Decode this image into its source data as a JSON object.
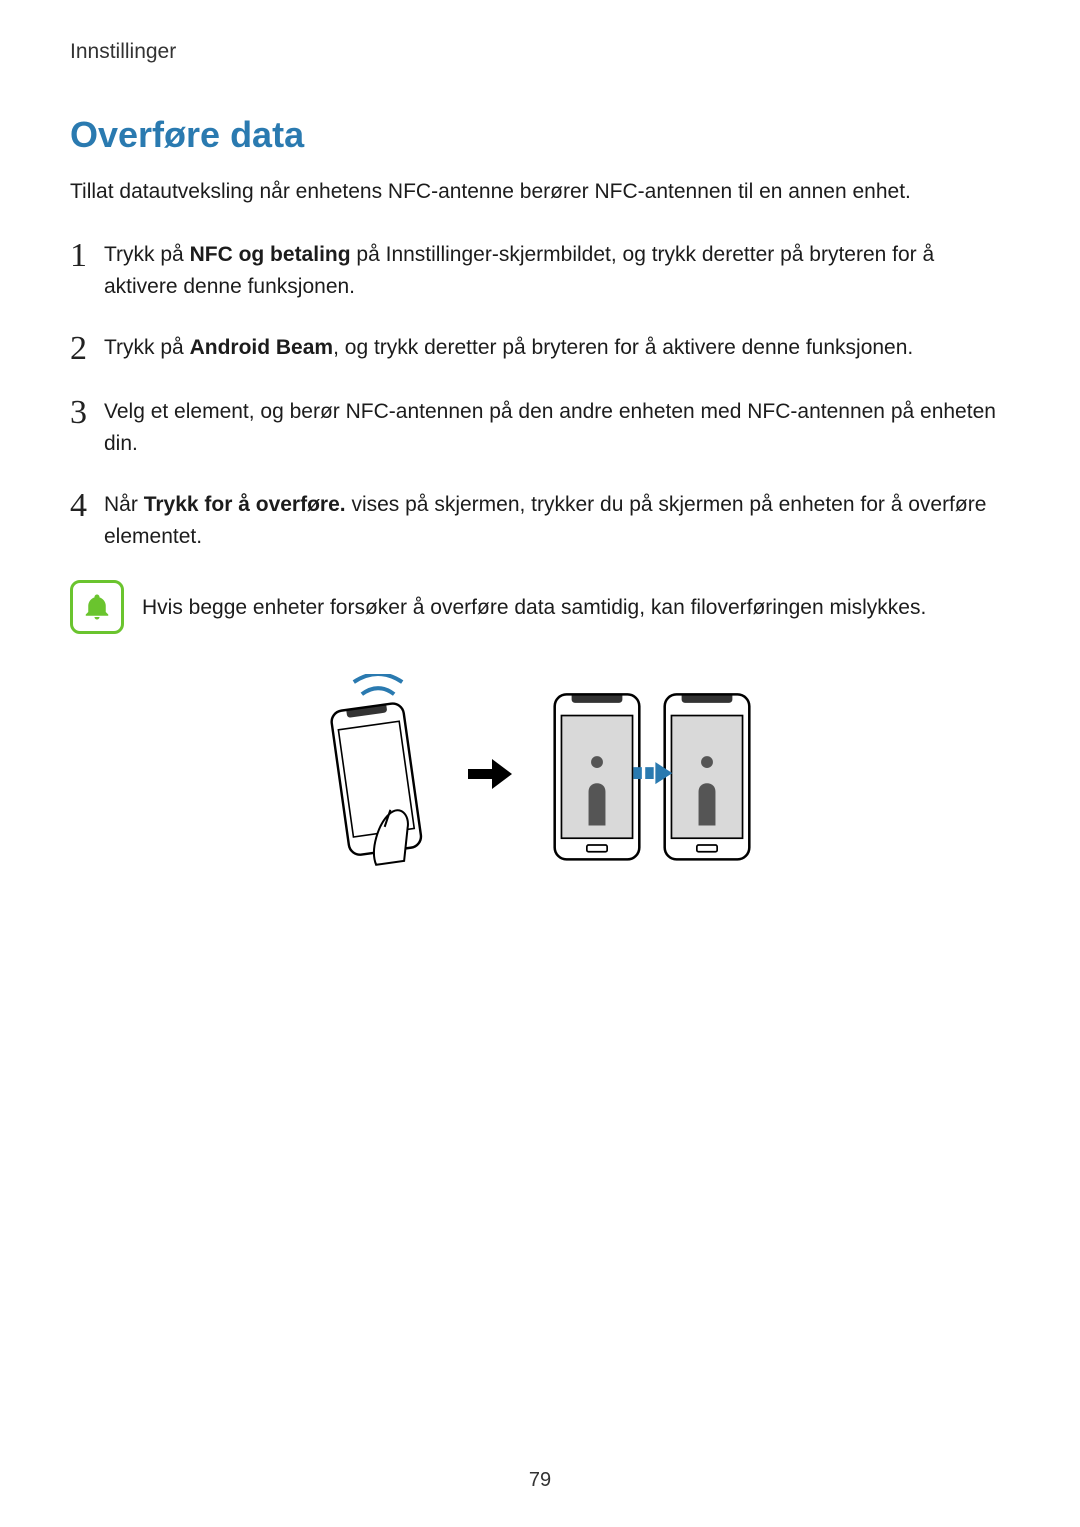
{
  "header": {
    "title": "Innstillinger"
  },
  "section": {
    "title": "Overføre data",
    "intro": "Tillat datautveksling når enhetens NFC-antenne berører NFC-antennen til en annen enhet."
  },
  "steps": [
    {
      "num": "1",
      "pre": "Trykk på ",
      "bold": "NFC og betaling",
      "post": " på Innstillinger-skjermbildet, og trykk deretter på bryteren for å aktivere denne funksjonen."
    },
    {
      "num": "2",
      "pre": "Trykk på ",
      "bold": "Android Beam",
      "post": ", og trykk deretter på bryteren for å aktivere denne funksjonen."
    },
    {
      "num": "3",
      "pre": "",
      "bold": "",
      "post": "Velg et element, og berør NFC-antennen på den andre enheten med NFC-antennen på enheten din."
    },
    {
      "num": "4",
      "pre": "Når ",
      "bold": "Trykk for å overføre.",
      "post": " vises på skjermen, trykker du på skjermen på enheten for å overføre elementet."
    }
  ],
  "note": {
    "text": "Hvis begge enheter forsøker å overføre data samtidig, kan filoverføringen mislykkes."
  },
  "page_number": "79",
  "colors": {
    "accent": "#2a7ab0",
    "note_border": "#6ac42e"
  }
}
